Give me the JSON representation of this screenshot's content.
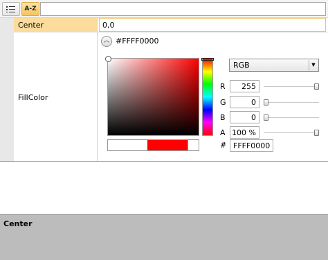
{
  "toolbar": {
    "categorized_icon": "categorized-list-icon",
    "alphabetical_label": "A-Z",
    "search_value": ""
  },
  "properties": {
    "center": {
      "name": "Center",
      "value": "0,0"
    },
    "fill_color": {
      "name": "FillColor",
      "hex_display": "#FFFF0000",
      "expander_icon": "chevron-up-icon",
      "mode": "RGB",
      "channels": [
        {
          "label": "R",
          "value": "255",
          "level": 1.0
        },
        {
          "label": "G",
          "value": "0",
          "level": 0.0
        },
        {
          "label": "B",
          "value": "0",
          "level": 0.0
        },
        {
          "label": "A",
          "value": "100 %",
          "level": 1.0
        }
      ],
      "hex_label": "#",
      "hex_value": "FFFF0000",
      "selected_color": "#ff0000",
      "previous_color": "#ffffff"
    }
  },
  "description": {
    "title": "Center"
  }
}
